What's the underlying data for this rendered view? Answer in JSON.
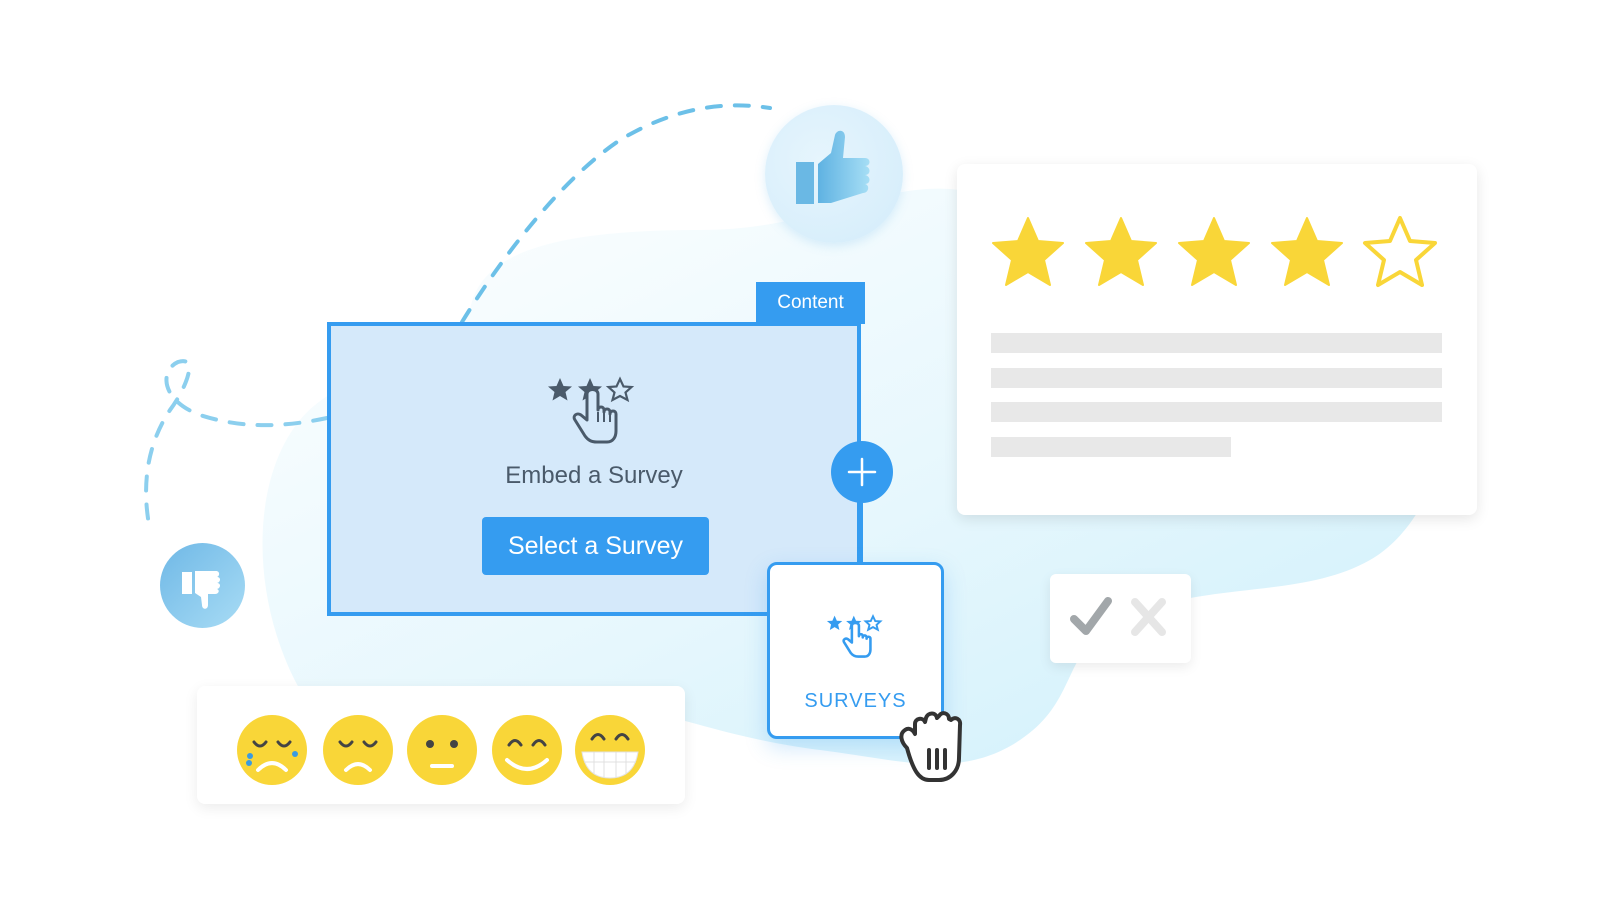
{
  "embed_panel": {
    "tab_label": "Content",
    "title": "Embed a Survey",
    "button_label": "Select a Survey",
    "icon": "star-rating-tap-icon"
  },
  "add_button": {
    "icon": "plus-icon"
  },
  "surveys_card": {
    "label": "SURVEYS",
    "icon": "star-rating-tap-icon"
  },
  "drag_cursor": {
    "icon": "grab-hand-cursor-icon"
  },
  "rating_card": {
    "rating": 4,
    "max_rating": 5,
    "star_color": "#f9d638"
  },
  "check_cross_card": {
    "icons": [
      "checkmark-icon",
      "cross-icon"
    ]
  },
  "emoji_scale": {
    "items": [
      "crying-face",
      "sad-face",
      "neutral-face",
      "smiling-face",
      "grinning-face"
    ]
  },
  "thumbs": {
    "up_icon": "thumbs-up-icon",
    "down_icon": "thumbs-down-icon"
  },
  "colors": {
    "accent": "#359cf0",
    "panel_bg": "#d5e9fa",
    "star": "#f9d638",
    "emoji": "#f9d638",
    "text_dark": "#4a5a6a",
    "placeholder_line": "#e8e8e8",
    "dashed_path": "#6cc0e8"
  }
}
